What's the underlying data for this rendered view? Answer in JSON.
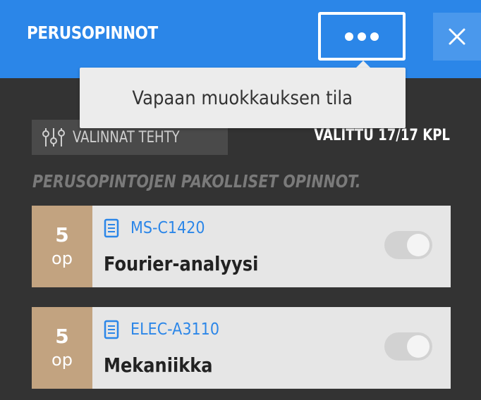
{
  "header": {
    "title": "PERUSOPINNOT",
    "menu_icon": "more-horizontal-icon",
    "close_icon": "close-icon"
  },
  "dropdown": {
    "item_label": "Vapaan muokkauksen tila"
  },
  "choices": {
    "icon": "sliders-icon",
    "label": "VALINNAT TEHTY",
    "selected_count": "VALITTU 17/17 KPL"
  },
  "section": {
    "title": "PERUSOPINTOJEN PAKOLLISET OPINNOT."
  },
  "courses": [
    {
      "credits": "5",
      "unit": "op",
      "code": "MS-C1420",
      "name": "Fourier-analyysi",
      "icon": "document-icon",
      "toggle_on": false
    },
    {
      "credits": "5",
      "unit": "op",
      "code": "ELEC-A3110",
      "name": "Mekaniikka",
      "icon": "document-icon",
      "toggle_on": false
    }
  ],
  "colors": {
    "header_bg": "#2b86e8",
    "page_bg": "#333333",
    "credits_bg": "#c2a380",
    "link": "#2b86e8"
  }
}
